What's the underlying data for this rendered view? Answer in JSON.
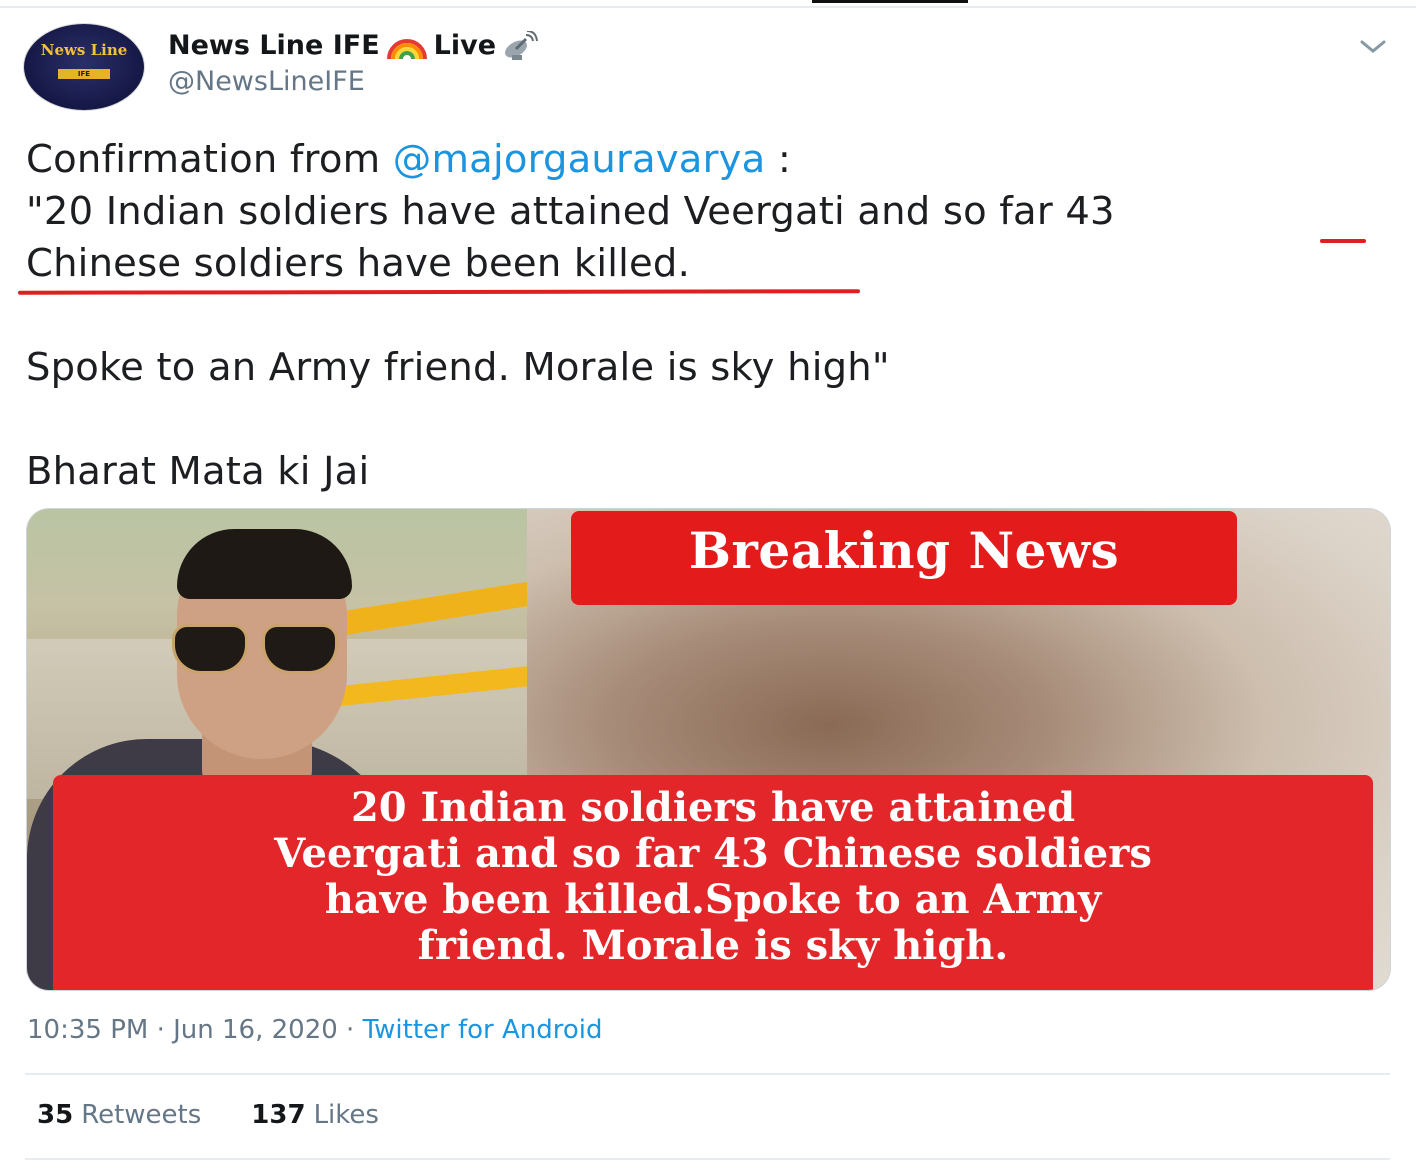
{
  "tweet": {
    "author": {
      "display_name": "News Line IFE",
      "live_label": "Live",
      "handle": "@NewsLineIFE",
      "avatar_title": "News Line",
      "avatar_bar": "IFE"
    },
    "text": {
      "line1_prefix": "Confirmation from ",
      "mention": "@majorgauravarya",
      "line1_suffix": " :",
      "line2": "\"20 Indian soldiers have attained Veergati and so far 43",
      "line3": "Chinese soldiers have been killed.",
      "line4": "Spoke to an Army friend. Morale is sky high\"",
      "line5": "Bharat Mata ki Jai"
    },
    "media": {
      "banner": "Breaking News",
      "caption_lines": [
        "20 Indian soldiers have attained",
        "Veergati and so far 43 Chinese soldiers",
        "have been killed.Spoke to an Army",
        "friend. Morale is sky high."
      ]
    },
    "meta": {
      "time": "10:35 PM",
      "separator1": " · ",
      "date": "Jun 16, 2020",
      "separator2": " · ",
      "source": "Twitter for Android"
    },
    "stats": {
      "retweets_count": "35",
      "retweets_label": "Retweets",
      "likes_count": "137",
      "likes_label": "Likes"
    }
  },
  "icons": {
    "rainbow": "rainbow-icon",
    "satellite": "satellite-antenna-icon",
    "chevron": "chevron-down-icon"
  },
  "colors": {
    "mention": "#1b95e0",
    "underline": "#e02020",
    "banner_red": "#e31b1b",
    "muted": "#657786"
  }
}
